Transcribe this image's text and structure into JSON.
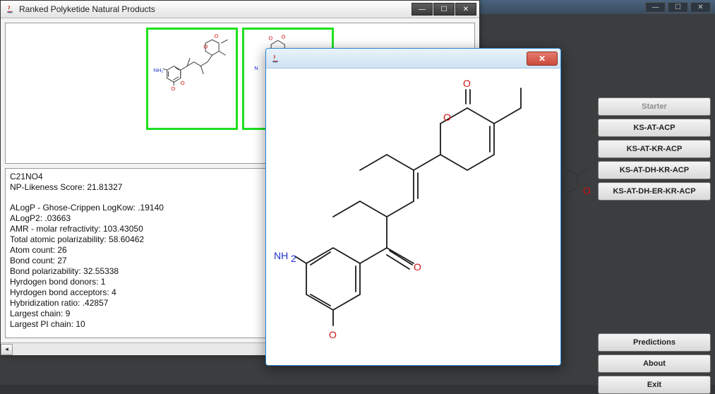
{
  "parent": {
    "min": "—",
    "max": "☐",
    "close": "✕"
  },
  "rightButtons": {
    "starter": "Starter",
    "b1": "KS-AT-ACP",
    "b2": "KS-AT-KR-ACP",
    "b3": "KS-AT-DH-KR-ACP",
    "b4": "KS-AT-DH-ER-KR-ACP",
    "predictions": "Predictions",
    "about": "About",
    "exit": "Exit"
  },
  "mainWindow": {
    "title": "Ranked Polyketide Natural Products",
    "min": "—",
    "max": "☐",
    "close": "✕"
  },
  "details": {
    "formula": "C21NO4",
    "np": "NP-Likeness Score: 21.81327",
    "alogp1": "ALogP - Ghose-Crippen LogKow: .19140",
    "alogp2": "ALogP2: .03663",
    "amr": "AMR - molar refractivity: 103.43050",
    "polar": "Total atomic polarizability: 58.60462",
    "atomc": "Atom count: 26",
    "bondc": "Bond count: 27",
    "bondp": "Bond polarizability: 32.55338",
    "hdon": "Hyrdogen bond donors: 1",
    "hacc": "Hyrdogen bond acceptors: 4",
    "hybr": "Hybridization ratio: .42857",
    "lchain": "Largest chain: 9",
    "lpchain": "Largest PI chain: 10"
  },
  "dialog": {
    "close": "✕"
  }
}
